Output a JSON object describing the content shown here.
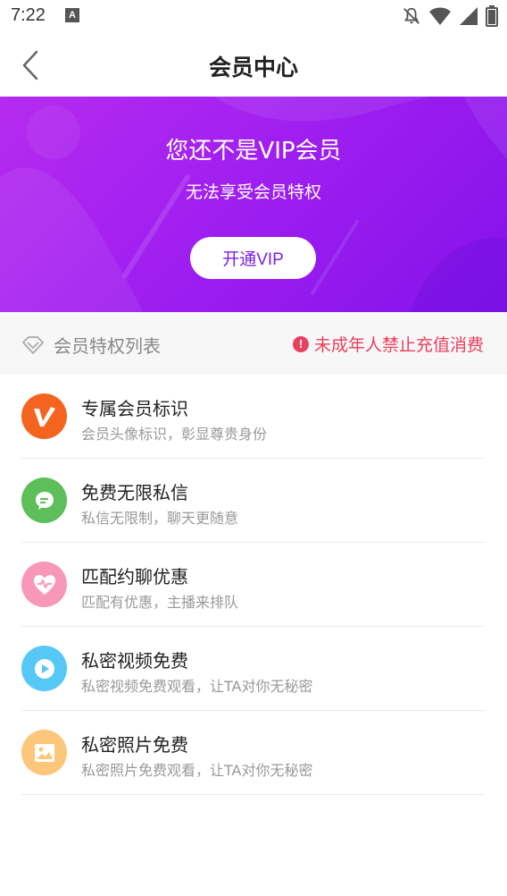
{
  "status_bar": {
    "time": "7:22",
    "notification_badge": "A",
    "icons": [
      "notifications-off-icon",
      "wifi-icon",
      "signal-icon",
      "battery-icon"
    ]
  },
  "header": {
    "title": "会员中心",
    "back_icon": "chevron-left-icon"
  },
  "banner": {
    "title": "您还不是VIP会员",
    "subtitle": "无法享受会员特权",
    "button_label": "开通VIP"
  },
  "privileges_section": {
    "title": "会员特权列表",
    "warning": "未成年人禁止充值消费",
    "warning_icon_text": "!"
  },
  "privileges": [
    {
      "title": "专属会员标识",
      "desc": "会员头像标识，彰显尊贵身份",
      "icon": "vip-v-icon",
      "color": "#f4641f"
    },
    {
      "title": "免费无限私信",
      "desc": "私信无限制，聊天更随意",
      "icon": "chat-bubble-icon",
      "color": "#5cbf5a"
    },
    {
      "title": "匹配约聊优惠",
      "desc": "匹配有优惠，主播来排队",
      "icon": "heart-pulse-icon",
      "color": "#f997b8"
    },
    {
      "title": "私密视频免费",
      "desc": "私密视频免费观看，让TA对你无秘密",
      "icon": "play-icon",
      "color": "#55c8f5"
    },
    {
      "title": "私密照片免费",
      "desc": "私密照片免费观看，让TA对你无秘密",
      "icon": "image-icon",
      "color": "#fcc67b"
    }
  ]
}
